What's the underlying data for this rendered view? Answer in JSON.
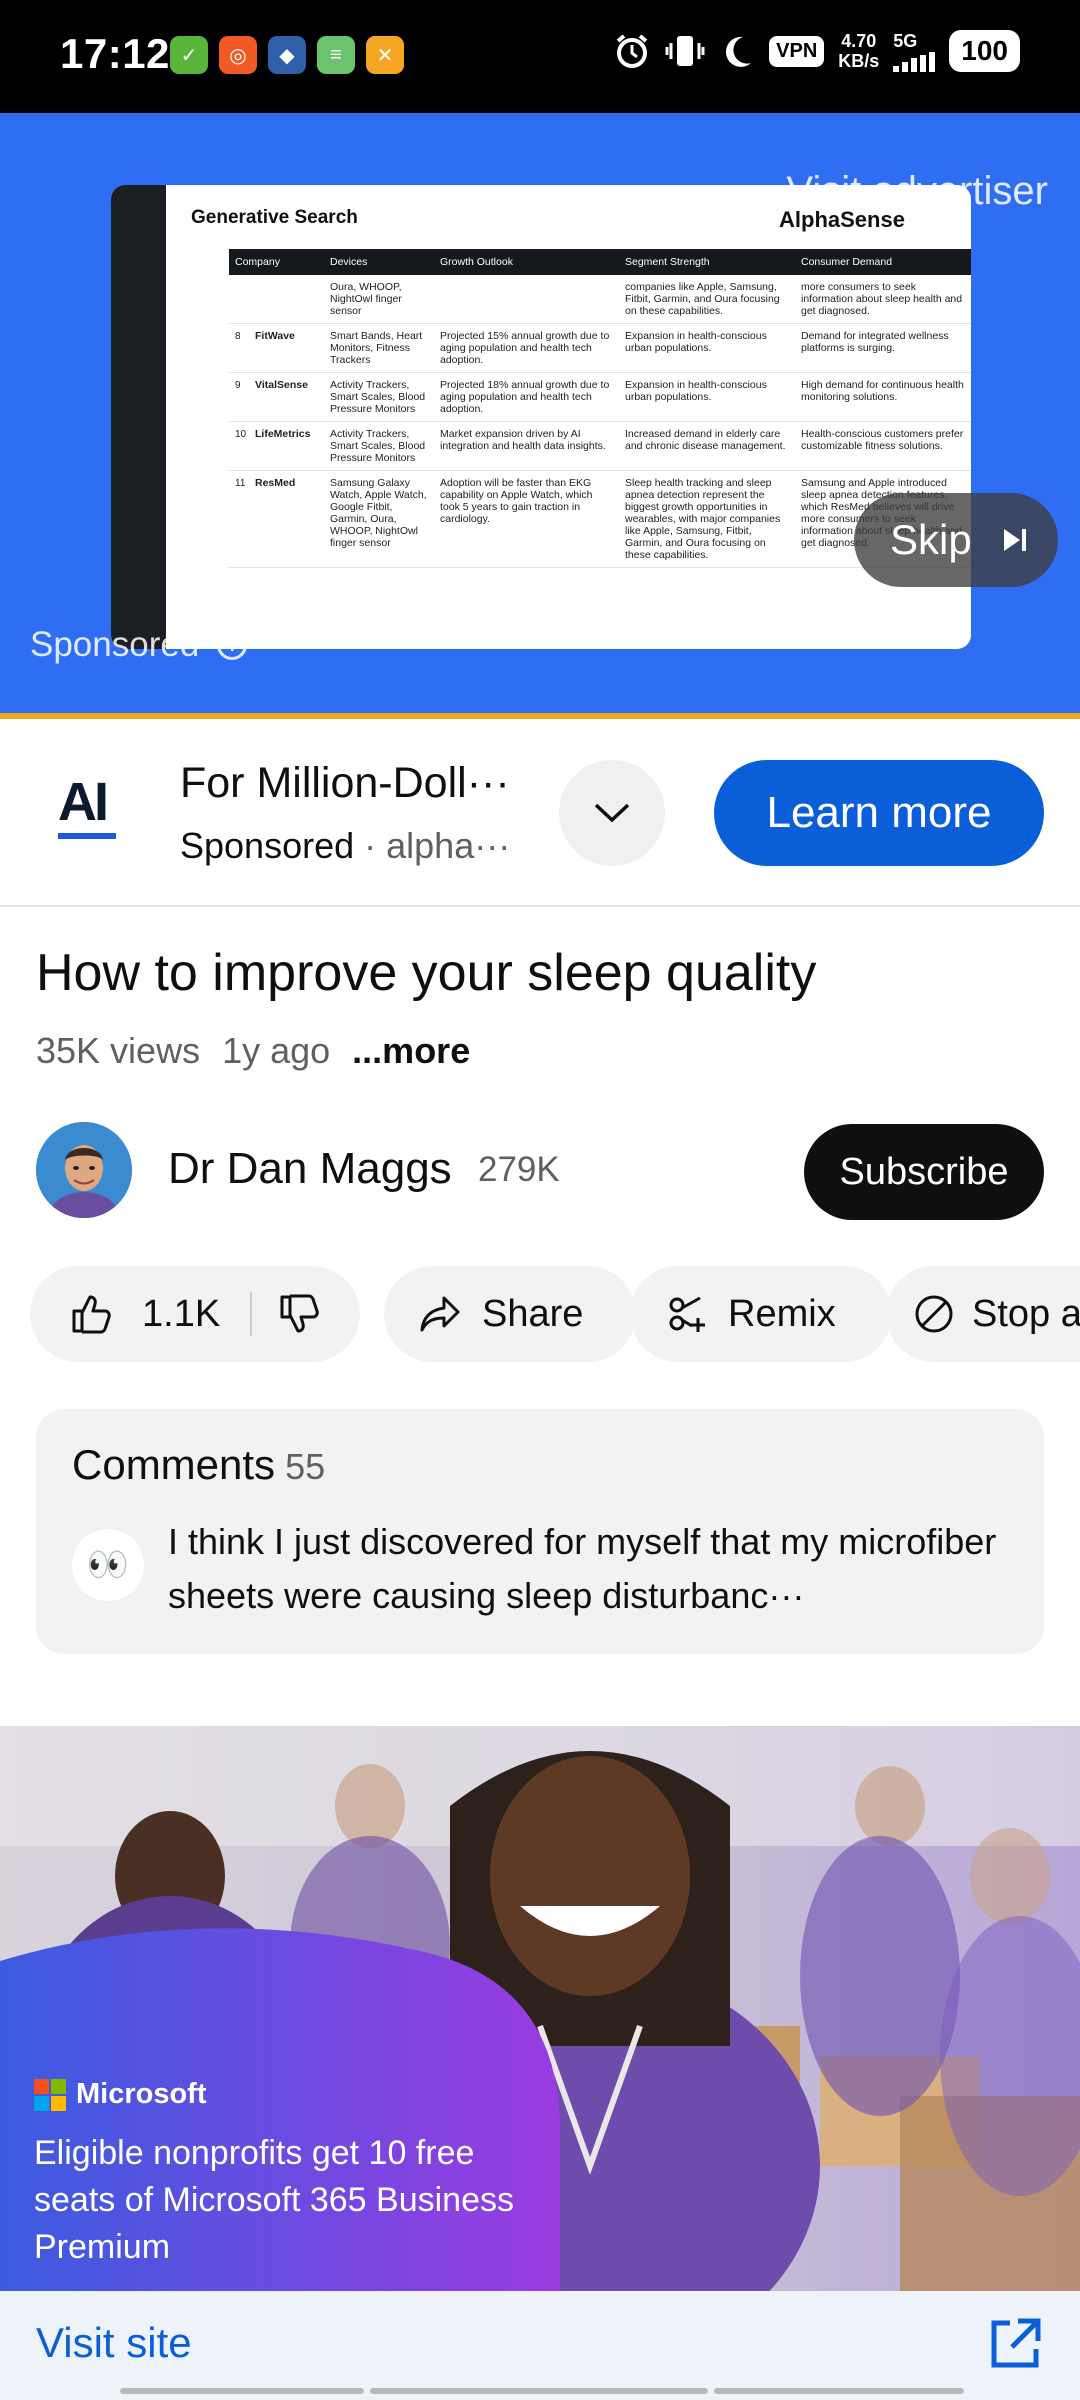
{
  "status_bar": {
    "time": "17:12",
    "vpn": "VPN",
    "speed_value": "4.70",
    "speed_unit": "KB/s",
    "network": "5G",
    "battery": "100",
    "app_icons": [
      "green-app-icon",
      "red-app-icon",
      "cat-app-icon",
      "green-tool-icon",
      "orange-tool-icon"
    ],
    "system_icons": [
      "alarm-icon",
      "vibrate-icon",
      "moon-icon",
      "signal-icon"
    ]
  },
  "ad_video": {
    "visit_advertiser": "Visit advertiser",
    "skip_label": "Skip",
    "sponsored_label": "Sponsored",
    "background_color": "#2f6df2",
    "screen": {
      "title": "Generative Search",
      "brand": "AlphaSense",
      "headers": [
        "Company",
        "Devices",
        "Growth Outlook",
        "Segment Strength",
        "Consumer Demand"
      ],
      "rows": [
        {
          "num": "",
          "company": "",
          "devices": "Oura, WHOOP, NightOwl finger sensor",
          "growth": "",
          "segment": "companies like Apple, Samsung, Fitbit, Garmin, and Oura focusing on these capabilities.",
          "demand": "more consumers to seek information about sleep health and get diagnosed."
        },
        {
          "num": "8",
          "company": "FitWave",
          "devices": "Smart Bands, Heart Monitors, Fitness Trackers",
          "growth": "Projected 15% annual growth due to aging population and health tech adoption.",
          "segment": "Expansion in health-conscious urban populations.",
          "demand": "Demand for integrated wellness platforms is surging."
        },
        {
          "num": "9",
          "company": "VitalSense",
          "devices": "Activity Trackers, Smart Scales, Blood Pressure Monitors",
          "growth": "Projected 18% annual growth due to aging population and health tech adoption.",
          "segment": "Expansion in health-conscious urban populations.",
          "demand": "High demand for continuous health monitoring solutions."
        },
        {
          "num": "10",
          "company": "LifeMetrics",
          "devices": "Activity Trackers, Smart Scales, Blood Pressure Monitors",
          "growth": "Market expansion driven by AI integration and health data insights.",
          "segment": "Increased demand in elderly care and chronic disease management.",
          "demand": "Health-conscious customers prefer customizable fitness solutions."
        },
        {
          "num": "11",
          "company": "ResMed",
          "devices": "Samsung Galaxy Watch, Apple Watch, Google Fitbit, Garmin, Oura, WHOOP, NightOwl finger sensor",
          "growth": "Adoption will be faster than EKG capability on Apple Watch, which took 5 years to gain traction in cardiology.",
          "segment": "Sleep health tracking and sleep apnea detection represent the biggest growth opportunities in wearables, with major companies like Apple, Samsung, Fitbit, Garmin, and Oura focusing on these capabilities.",
          "demand": "Samsung and Apple introduced sleep apnea detection features, which ResMed believes will drive more consumers to seek information about sleep health and get diagnosed."
        }
      ]
    }
  },
  "ad_banner": {
    "logo_text": "AI",
    "title": "For Million-Doll···",
    "sponsored": "Sponsored",
    "separator": " · ",
    "domain": "alpha···",
    "learn_more": "Learn more",
    "accent_color": "#0a5fd8"
  },
  "video": {
    "title": "How to improve your sleep quality",
    "views": "35K views",
    "age": "1y ago",
    "more": "...more"
  },
  "channel": {
    "name": "Dr Dan Maggs",
    "subscribers": "279K",
    "subscribe_label": "Subscribe"
  },
  "actions": {
    "likes": "1.1K",
    "share": "Share",
    "remix": "Remix",
    "stop": "Stop a"
  },
  "comments": {
    "title": "Comments",
    "count": "55",
    "top_avatar": "👀",
    "top_comment": "I think I just discovered for myself that my microfiber sheets were causing sleep disturbanc···"
  },
  "bottom_ad": {
    "brand": "Microsoft",
    "text": "Eligible nonprofits get 10 free seats of Microsoft 365 Business Premium",
    "visit_site": "Visit site"
  }
}
